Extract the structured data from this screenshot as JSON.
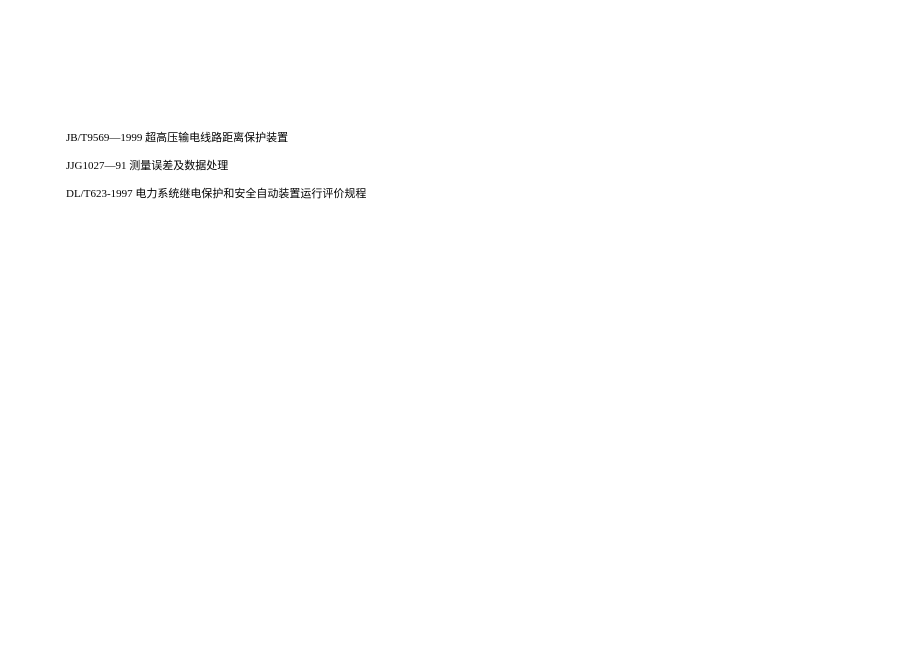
{
  "references": [
    {
      "code": "JB/T9569—1999",
      "title": "超高压输电线路距离保护装置"
    },
    {
      "code": "JJG1027—91",
      "title": "测量误差及数据处理"
    },
    {
      "code": "DL/T623-1997",
      "title": "电力系统继电保护和安全自动装置运行评价规程"
    }
  ]
}
